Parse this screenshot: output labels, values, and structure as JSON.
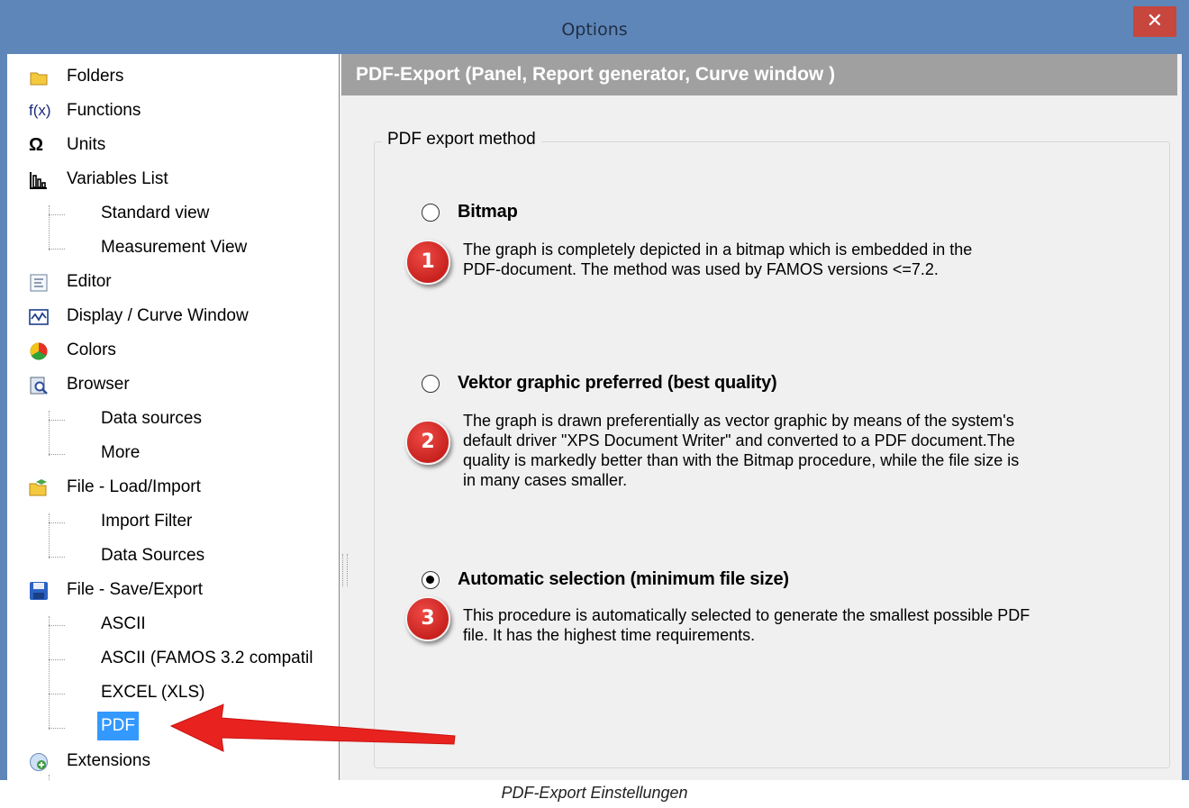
{
  "window": {
    "title": "Options",
    "close_label": "✕"
  },
  "tree": {
    "items": [
      {
        "label": "Folders"
      },
      {
        "label": "Functions"
      },
      {
        "label": "Units"
      },
      {
        "label": "Variables List"
      },
      {
        "label": "Standard view"
      },
      {
        "label": "Measurement View"
      },
      {
        "label": "Editor"
      },
      {
        "label": "Display / Curve Window"
      },
      {
        "label": "Colors"
      },
      {
        "label": "Browser"
      },
      {
        "label": "Data sources"
      },
      {
        "label": "More"
      },
      {
        "label": "File - Load/Import"
      },
      {
        "label": "Import Filter"
      },
      {
        "label": "Data Sources"
      },
      {
        "label": "File - Save/Export"
      },
      {
        "label": "ASCII"
      },
      {
        "label": "ASCII (FAMOS 3.2 compatil"
      },
      {
        "label": "EXCEL (XLS)"
      },
      {
        "label": "PDF"
      },
      {
        "label": "Extensions"
      }
    ],
    "selected": "PDF",
    "function_icon_text": "f(x)",
    "units_icon_text": "Ω"
  },
  "panel": {
    "header": "PDF-Export (Panel, Report generator, Curve window )",
    "group_title": "PDF export method",
    "options": [
      {
        "label": "Bitmap",
        "selected": false,
        "badge": "1",
        "desc_lines": [
          "The graph is completely depicted in a bitmap which is embedded in the",
          "PDF-document. The method was used by FAMOS versions <=7.2."
        ]
      },
      {
        "label": "Vektor graphic preferred (best quality)",
        "selected": false,
        "badge": "2",
        "desc_lines": [
          "The graph is drawn preferentially as vector graphic by means of the system's",
          "default driver \"XPS Document Writer\" and converted to a PDF document.The",
          "quality is markedly better than with the Bitmap procedure, while the file size is",
          "in many cases smaller."
        ]
      },
      {
        "label": "Automatic selection (minimum file size)",
        "selected": true,
        "badge": "3",
        "desc_lines": [
          "This procedure is automatically selected to generate the smallest possible PDF",
          "file. It has the highest time requirements."
        ]
      }
    ]
  },
  "caption": "PDF-Export Einstellungen",
  "colors": {
    "titlebar": "#5e86b8",
    "close": "#c7463d",
    "selection": "#3399ff",
    "header": "#a0a0a0",
    "badge": "#d8302b",
    "arrow": "#e8231f"
  }
}
